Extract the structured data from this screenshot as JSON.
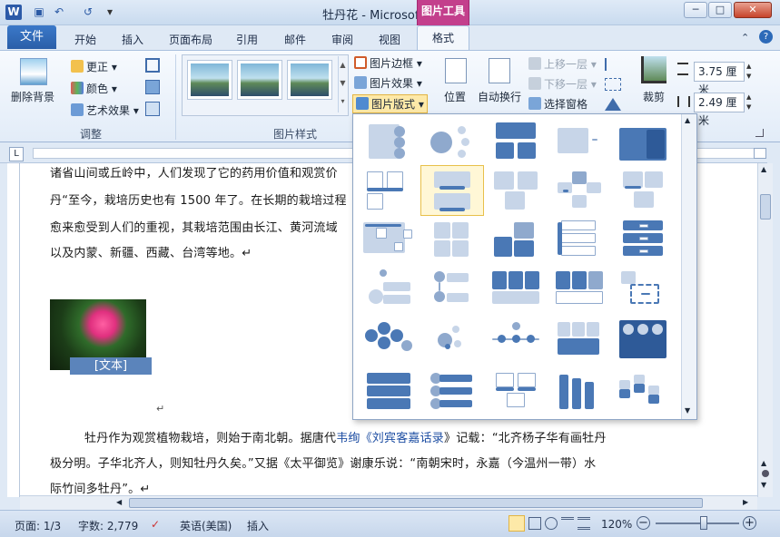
{
  "window": {
    "title": "牡丹花 - Microsoft Word",
    "context_tab_group": "图片工具",
    "minimize": "─",
    "maximize": "□",
    "close": "✕"
  },
  "qat": {
    "save_icon": "save-icon",
    "undo_icon": "undo-icon",
    "redo_icon": "redo-icon"
  },
  "tabs": [
    "文件",
    "开始",
    "插入",
    "页面布局",
    "引用",
    "邮件",
    "审阅",
    "视图",
    "格式"
  ],
  "ribbon": {
    "adjust": {
      "remove_bg": "删除背景",
      "corrections": "更正",
      "color": "颜色",
      "artistic": "艺术效果",
      "label": "调整"
    },
    "styles": {
      "label": "图片样式",
      "border": "图片边框",
      "effects": "图片效果",
      "layout": "图片版式"
    },
    "arrange": {
      "position": "位置",
      "wrap": "自动换行",
      "bring_forward": "上移一层",
      "send_backward": "下移一层",
      "selection_pane": "选择窗格"
    },
    "size": {
      "crop": "裁剪",
      "height": "3.75 厘米",
      "width": "2.49 厘米"
    }
  },
  "document": {
    "lines": [
      "诸省山间或丘岭中，人们发现了它的药用价值和观赏价",
      "丹“至今，栽培历史也有 1500 年了。在长期的栽培过程",
      "愈来愈受到人们的重视，其栽培范围由长江、黄河流域",
      "以及内蒙、新疆、西藏、台湾等地。↵"
    ],
    "image_caption": "[文本]",
    "para_mark": "↵",
    "para2_line1_a": "牡丹作为观赏植物栽培，则始于南北朝。据唐代",
    "para2_line1_link": "韦绚《刘宾客嘉话录",
    "para2_line1_b": "》记载：“北齐杨子华有画牡丹",
    "para2_line2": "极分明。子华北齐人，则知牡丹久矣。”又据《太平御览》谢康乐说：“南朝宋时，永嘉（今温州一带）水",
    "para2_line3": "际竹间多牡丹”。↵"
  },
  "status": {
    "page": "页面: 1/3",
    "words": "字数: 2,779",
    "language": "英语(美国)",
    "mode": "插入",
    "zoom": "120%",
    "zoom_level": 0.58
  },
  "colors": {
    "accent": "#2a5ea8",
    "context": "#c33f8c",
    "smart_art_blue": "#4a78b5"
  }
}
